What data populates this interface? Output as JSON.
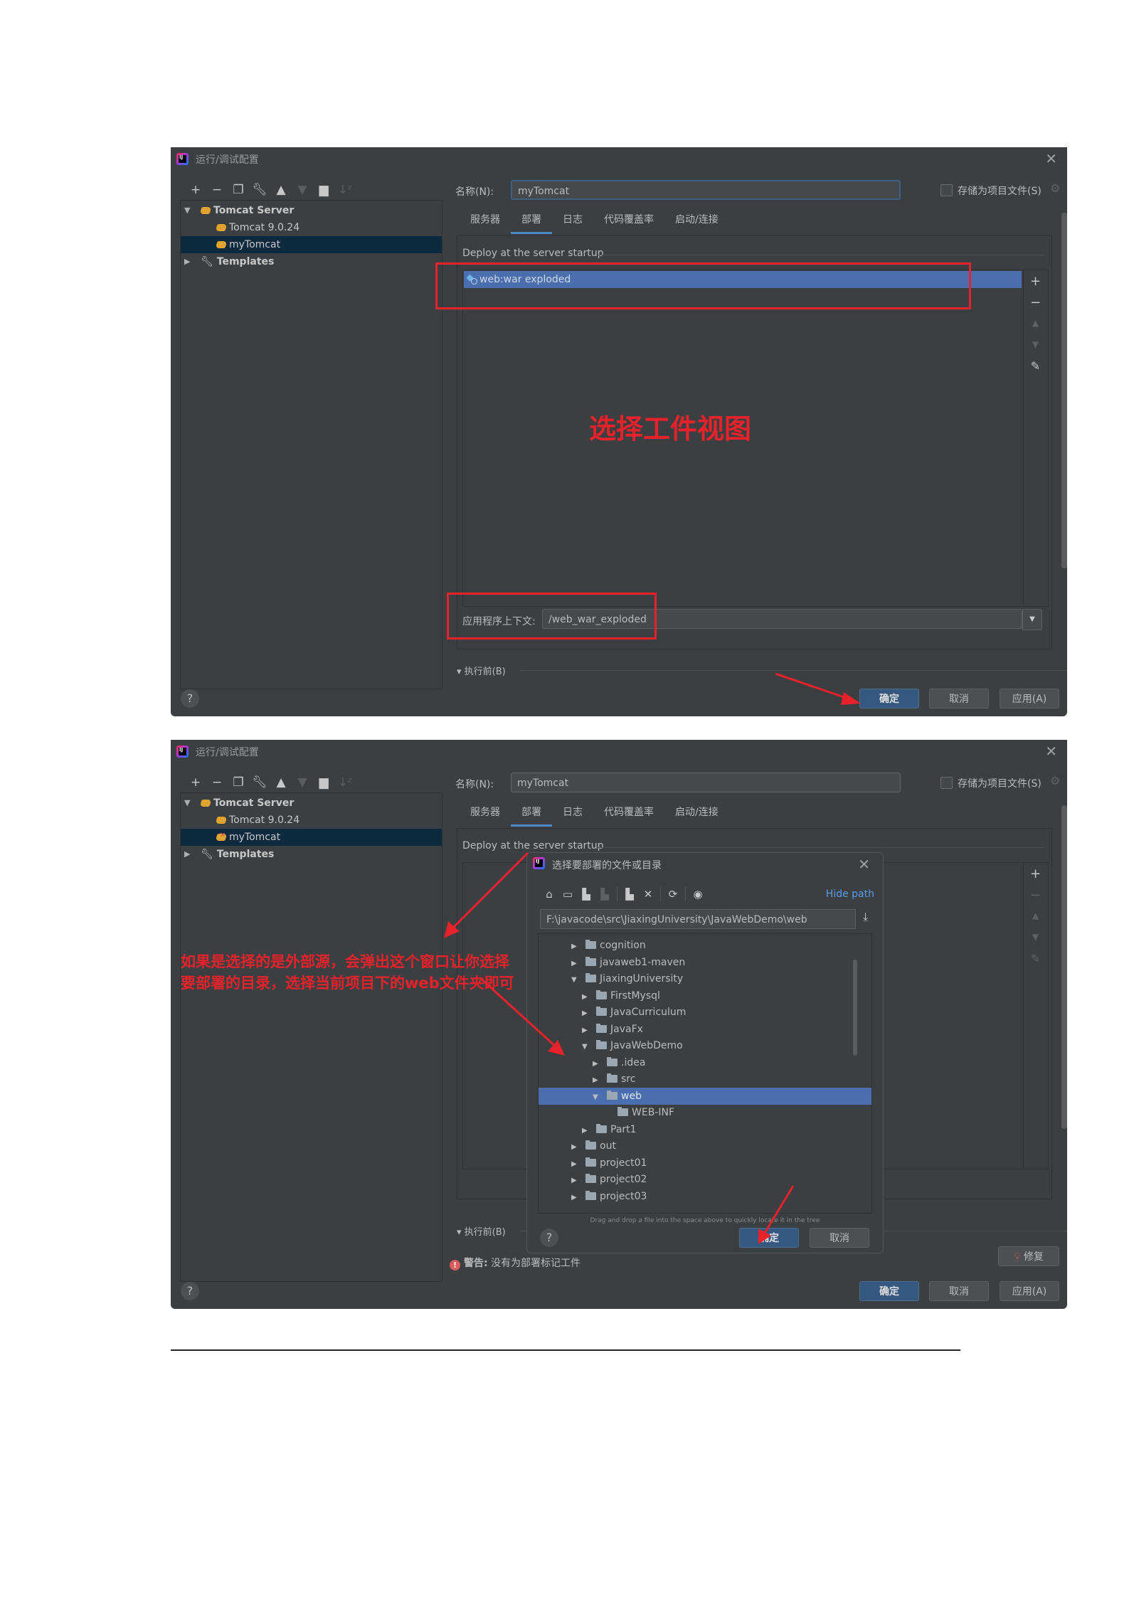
{
  "dialog1": {
    "title": "运行/调试配置",
    "toolbar": [
      "add",
      "remove",
      "copy",
      "edit-defaults",
      "move-up",
      "move-down",
      "new-folder",
      "sort"
    ],
    "tree": [
      {
        "label": "Tomcat Server",
        "bold": true,
        "expanded": true,
        "level": 0
      },
      {
        "label": "Tomcat 9.0.24",
        "level": 1
      },
      {
        "label": "myTomcat",
        "level": 1,
        "selected": true
      },
      {
        "label": "Templates",
        "bold": true,
        "expanded": false,
        "level": 0
      }
    ],
    "name_label": "名称(N):",
    "name_value": "myTomcat",
    "store_label": "存储为项目文件(S)",
    "store_checked": false,
    "tabs": [
      "服务器",
      "部署",
      "日志",
      "代码覆盖率",
      "启动/连接"
    ],
    "active_tab": "部署",
    "deploy_section_title": "Deploy at the server startup",
    "deploy_items": [
      "web:war exploded"
    ],
    "context_label": "应用程序上下文:",
    "context_value": "/web_war_exploded",
    "before_launch": "执行前(B)",
    "help": "?",
    "ok": "确定",
    "cancel": "取消",
    "apply": "应用(A)",
    "annotation": "选择工件视图"
  },
  "dialog2": {
    "title": "运行/调试配置",
    "tree": [
      {
        "label": "Tomcat Server",
        "bold": true,
        "expanded": true,
        "level": 0
      },
      {
        "label": "Tomcat 9.0.24",
        "level": 1
      },
      {
        "label": "myTomcat",
        "level": 1,
        "selected": true,
        "error": true
      },
      {
        "label": "Templates",
        "bold": true,
        "expanded": false,
        "level": 0
      }
    ],
    "name_label": "名称(N):",
    "name_value": "myTomcat",
    "store_label": "存储为项目文件(S)",
    "tabs": [
      "服务器",
      "部署",
      "日志",
      "代码覆盖率",
      "启动/连接"
    ],
    "active_tab": "部署",
    "deploy_section_title": "Deploy at the server startup",
    "before_launch": "执行前(B)",
    "warning_prefix": "警告:",
    "warning_text": "没有为部署标记工件",
    "fix": "修复",
    "help": "?",
    "ok": "确定",
    "cancel": "取消",
    "apply": "应用(A)",
    "annotation_line1": "如果是选择的是外部源，会弹出这个窗口让你选择",
    "annotation_line2": "要部署的目录，选择当前项目下的web文件夹即可"
  },
  "chooser": {
    "title": "选择要部署的文件或目录",
    "hide_path": "Hide path",
    "path": "F:\\javacode\\src\\JiaxingUniversity\\JavaWebDemo\\web",
    "tree": [
      {
        "label": "cognition",
        "level": 0,
        "arrow": "collapsed"
      },
      {
        "label": "javaweb1-maven",
        "level": 0,
        "arrow": "collapsed"
      },
      {
        "label": "JiaxingUniversity",
        "level": 0,
        "arrow": "expanded"
      },
      {
        "label": "FirstMysql",
        "level": 1,
        "arrow": "collapsed"
      },
      {
        "label": "JavaCurriculum",
        "level": 1,
        "arrow": "collapsed"
      },
      {
        "label": "JavaFx",
        "level": 1,
        "arrow": "collapsed"
      },
      {
        "label": "JavaWebDemo",
        "level": 1,
        "arrow": "expanded"
      },
      {
        "label": ".idea",
        "level": 2,
        "arrow": "collapsed"
      },
      {
        "label": "src",
        "level": 2,
        "arrow": "collapsed"
      },
      {
        "label": "web",
        "level": 2,
        "arrow": "expanded",
        "selected": true
      },
      {
        "label": "WEB-INF",
        "level": 3,
        "arrow": "none"
      },
      {
        "label": "Part1",
        "level": 1,
        "arrow": "collapsed"
      },
      {
        "label": "out",
        "level": 0,
        "arrow": "collapsed"
      },
      {
        "label": "project01",
        "level": 0,
        "arrow": "collapsed"
      },
      {
        "label": "project02",
        "level": 0,
        "arrow": "collapsed"
      },
      {
        "label": "project03",
        "level": 0,
        "arrow": "collapsed"
      }
    ],
    "hint": "Drag and drop a file into the space above to quickly locate it in the tree",
    "help": "?",
    "ok": "确定",
    "cancel": "取消"
  },
  "colors": {
    "annotation_red": "#e8222a",
    "selection_blue": "#4b6eaf",
    "primary_button": "#365880",
    "link_blue": "#589df6"
  }
}
